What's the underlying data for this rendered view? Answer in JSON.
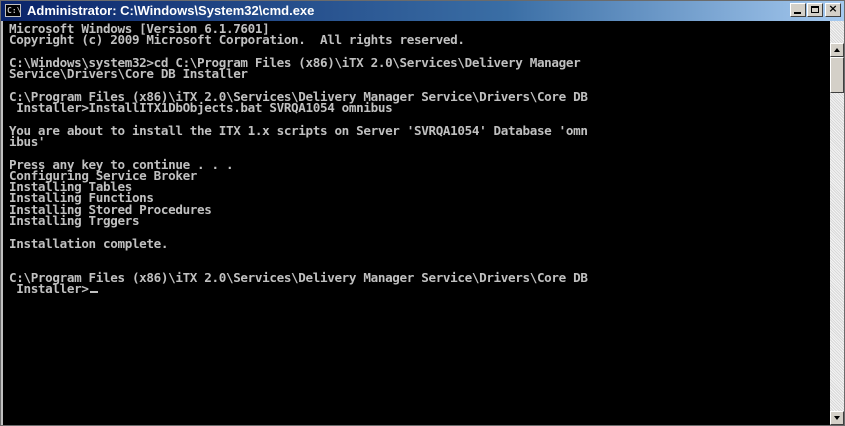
{
  "window": {
    "title": "Administrator: C:\\Windows\\System32\\cmd.exe",
    "icon_label": "C:\\",
    "icon": "cmd-icon",
    "buttons": [
      "minimize-icon",
      "maximize-icon",
      "close-icon"
    ],
    "close_glyph": "×"
  },
  "console": {
    "background": "#000000",
    "foreground": "#c0c0c0",
    "lines": [
      "Microsoft Windows [Version 6.1.7601]",
      "Copyright (c) 2009 Microsoft Corporation.  All rights reserved.",
      "",
      "C:\\Windows\\system32>cd C:\\Program Files (x86)\\iTX 2.0\\Services\\Delivery Manager",
      "Service\\Drivers\\Core DB Installer",
      "",
      "C:\\Program Files (x86)\\iTX 2.0\\Services\\Delivery Manager Service\\Drivers\\Core DB",
      " Installer>InstallITX1DbObjects.bat SVRQA1054 omnibus",
      "",
      "You are about to install the ITX 1.x scripts on Server 'SVRQA1054' Database 'omn",
      "ibus'",
      "",
      "Press any key to continue . . .",
      "Configuring Service Broker",
      "Installing Tables",
      "Installing Functions",
      "Installing Stored Procedures",
      "Installing Trggers",
      "",
      "Installation complete.",
      "",
      "",
      "C:\\Program Files (x86)\\iTX 2.0\\Services\\Delivery Manager Service\\Drivers\\Core DB",
      " Installer>"
    ]
  },
  "scrollbar": {
    "up": "arrow-up-icon",
    "down": "arrow-down-icon"
  }
}
